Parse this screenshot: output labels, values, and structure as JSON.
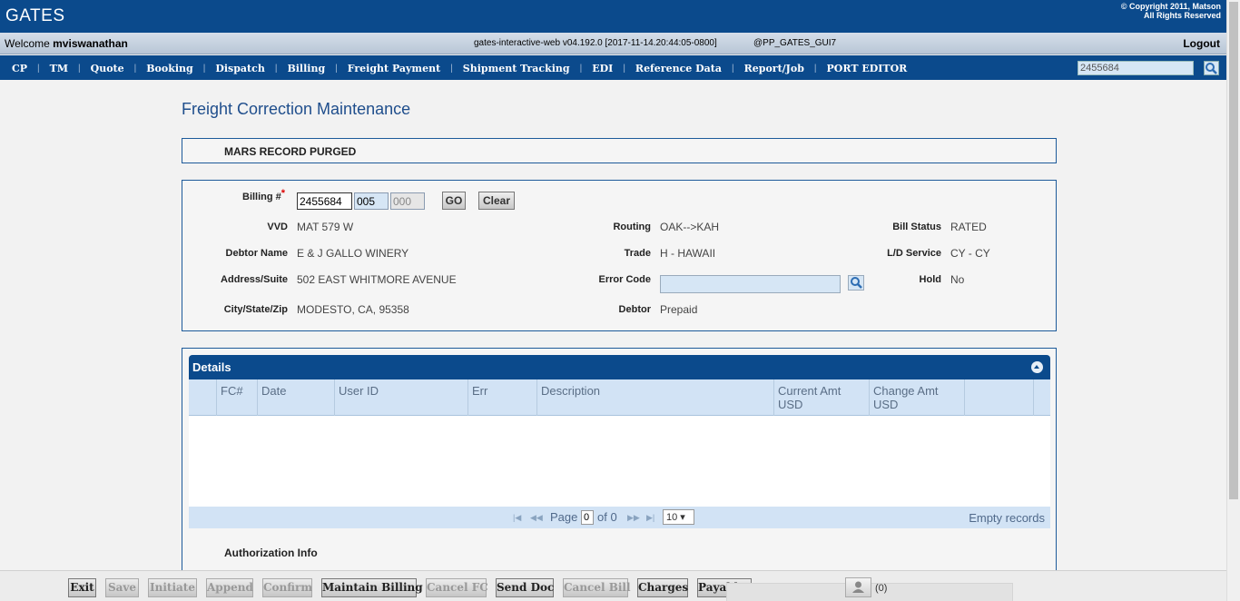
{
  "header": {
    "logo": "GATES",
    "copyright_line1": "© Copyright 2011, Matson",
    "copyright_line2": "All Rights Reserved"
  },
  "welcome": {
    "prefix": "Welcome",
    "username": "mviswanathan",
    "version": "gates-interactive-web v04.192.0 [2017-11-14.20:44:05-0800]",
    "environment": "@PP_GATES_GUI7",
    "logout": "Logout"
  },
  "nav": {
    "items": [
      "CP",
      "TM",
      "Quote",
      "Booking",
      "Dispatch",
      "Billing",
      "Freight Payment",
      "Shipment Tracking",
      "EDI",
      "Reference Data",
      "Report/Job",
      "PORT EDITOR"
    ],
    "search_value": "2455684"
  },
  "page": {
    "title": "Freight Correction Maintenance",
    "message": "MARS RECORD PURGED"
  },
  "form": {
    "billing_label": "Billing #",
    "required_mark": "*",
    "billing_no": "2455684",
    "billing_suffix1": "005",
    "billing_suffix2": "000",
    "go_button": "GO",
    "clear_button": "Clear",
    "vvd_label": "VVD",
    "vvd": "MAT 579 W",
    "debtor_name_label": "Debtor Name",
    "debtor_name": "E & J GALLO WINERY",
    "address_label": "Address/Suite",
    "address": "502 EAST WHITMORE AVENUE",
    "city_label": "City/State/Zip",
    "city": "MODESTO, CA, 95358",
    "routing_label": "Routing",
    "routing": "OAK-->KAH",
    "trade_label": "Trade",
    "trade": "H - HAWAII",
    "error_code_label": "Error Code",
    "debtor_label": "Debtor",
    "debtor": "Prepaid",
    "bill_status_label": "Bill Status",
    "bill_status": "RATED",
    "ld_service_label": "L/D Service",
    "ld_service": "CY - CY",
    "hold_label": "Hold",
    "hold": "No"
  },
  "details": {
    "title": "Details",
    "columns": {
      "fc": "FC#",
      "date": "Date",
      "user_id": "User ID",
      "err": "Err",
      "description": "Description",
      "current_amt_1": "Current Amt",
      "current_amt_2": "USD",
      "change_amt_1": "Change Amt",
      "change_amt_2": "USD"
    },
    "pager": {
      "page_label": "Page",
      "page_value": "0",
      "of_label": "of 0",
      "page_size": "10 ▾",
      "empty": "Empty records"
    }
  },
  "auth": {
    "title": "Authorization Info"
  },
  "toolbar": {
    "exit": "Exit",
    "save": "Save",
    "initiate": "Initiate",
    "append": "Append",
    "confirm": "Confirm",
    "maintain_billing": "Maintain Billing",
    "cancel_fc": "Cancel FC",
    "send_doc": "Send Doc",
    "cancel_bill": "Cancel Bill",
    "charges": "Charges",
    "payables": "Payables",
    "user_count": "(0)"
  },
  "colors": {
    "brand": "#0b4a8c",
    "grid_header": "#d2e3f5"
  }
}
